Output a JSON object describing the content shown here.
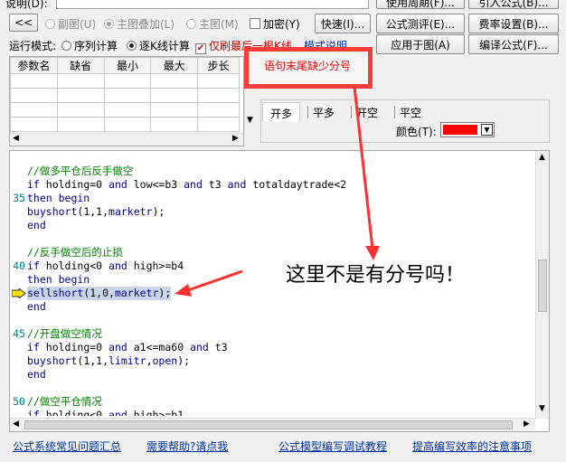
{
  "top": {
    "title_label": "说明(D):",
    "buttons_top": [
      "使用周期(F)...",
      "引入公式(B)..."
    ]
  },
  "row1": {
    "collapse": "<<",
    "radio_subchart": "副图(U)",
    "radio_overlay": "主图叠加(L)",
    "radio_main": "主图(M)",
    "check_encrypt": "加密(Y)",
    "btn_quick": "快速(I)...",
    "btn_test": "公式测评(E)...",
    "btn_fee": "费率设置(B)..."
  },
  "row2": {
    "mode_label": "运行模式:",
    "radio_seq": "序列计算",
    "radio_step": "逐K线计算",
    "check_tail": "仅刷最后一根K线",
    "link_doc": "模式说明",
    "btn_apply": "应用于图(A)",
    "btn_compile": "编译公式(F)..."
  },
  "params": {
    "headers": [
      "参数名",
      "缺省",
      "最小",
      "最大",
      "步长"
    ],
    "rows": 4
  },
  "error": {
    "message": "语句末尾缺少分号"
  },
  "tabs": [
    "开多",
    "平多",
    "开空",
    "平空"
  ],
  "color_label": "颜色(T):",
  "annotation": "这里不是有分号吗！",
  "code_lines": [
    {
      "num": "",
      "y": 0,
      "parts": [
        {
          "c": "cmt",
          "t": "//做多平仓后反手做空"
        }
      ]
    },
    {
      "num": "",
      "y": 1,
      "parts": [
        {
          "c": "kw",
          "t": "if"
        },
        {
          "c": "",
          "t": " holding=0 "
        },
        {
          "c": "kw",
          "t": "and"
        },
        {
          "c": "",
          "t": " low<=b3 "
        },
        {
          "c": "kw",
          "t": "and"
        },
        {
          "c": "",
          "t": " t3 "
        },
        {
          "c": "kw",
          "t": "and"
        },
        {
          "c": "",
          "t": " totaldaytrade<2"
        }
      ]
    },
    {
      "num": "35",
      "y": 2,
      "parts": [
        {
          "c": "kw",
          "t": "then begin"
        }
      ]
    },
    {
      "num": "",
      "y": 3,
      "parts": [
        {
          "c": "fn",
          "t": "buyshort"
        },
        {
          "c": "",
          "t": "(1,1,"
        },
        {
          "c": "fn",
          "t": "marketr"
        },
        {
          "c": "",
          "t": ");"
        }
      ]
    },
    {
      "num": "",
      "y": 4,
      "parts": [
        {
          "c": "kw",
          "t": "end"
        }
      ]
    },
    {
      "num": "",
      "y": 5,
      "parts": []
    },
    {
      "num": "",
      "y": 6,
      "parts": [
        {
          "c": "cmt",
          "t": "//反手做空后的止损"
        }
      ]
    },
    {
      "num": "40",
      "y": 7,
      "parts": [
        {
          "c": "kw",
          "t": "if"
        },
        {
          "c": "",
          "t": " holding<0 "
        },
        {
          "c": "kw",
          "t": "and"
        },
        {
          "c": "",
          "t": " high>=b4"
        }
      ]
    },
    {
      "num": "",
      "y": 8,
      "parts": [
        {
          "c": "kw",
          "t": "then begin"
        }
      ]
    },
    {
      "num": "",
      "y": 9,
      "parts": [
        {
          "c": "fn",
          "t": "sellshort"
        },
        {
          "c": "",
          "t": "(1,0,"
        },
        {
          "c": "fn",
          "t": "marketr"
        },
        {
          "c": "",
          "t": ");"
        }
      ],
      "hl": true
    },
    {
      "num": "",
      "y": 10,
      "parts": [
        {
          "c": "kw",
          "t": "end"
        }
      ]
    },
    {
      "num": "",
      "y": 11,
      "parts": []
    },
    {
      "num": "45",
      "y": 12,
      "parts": [
        {
          "c": "cmt",
          "t": "//开盘做空情况"
        }
      ]
    },
    {
      "num": "",
      "y": 13,
      "parts": [
        {
          "c": "kw",
          "t": "if"
        },
        {
          "c": "",
          "t": " holding=0 "
        },
        {
          "c": "kw",
          "t": "and"
        },
        {
          "c": "",
          "t": " a1<=ma60 "
        },
        {
          "c": "kw",
          "t": "and"
        },
        {
          "c": "",
          "t": " t3"
        }
      ]
    },
    {
      "num": "",
      "y": 14,
      "parts": [
        {
          "c": "fn",
          "t": "buyshort"
        },
        {
          "c": "",
          "t": "(1,1,"
        },
        {
          "c": "fn",
          "t": "limitr"
        },
        {
          "c": "",
          "t": ","
        },
        {
          "c": "fn",
          "t": "open"
        },
        {
          "c": "",
          "t": ");"
        }
      ]
    },
    {
      "num": "",
      "y": 15,
      "parts": [
        {
          "c": "kw",
          "t": "end"
        }
      ]
    },
    {
      "num": "",
      "y": 16,
      "parts": []
    },
    {
      "num": "50",
      "y": 17,
      "parts": [
        {
          "c": "cmt",
          "t": "//做空平仓情况"
        }
      ]
    },
    {
      "num": "",
      "y": 18,
      "parts": [
        {
          "c": "kw",
          "t": "if"
        },
        {
          "c": "",
          "t": " holding<0 "
        },
        {
          "c": "kw",
          "t": "and"
        },
        {
          "c": "",
          "t": " high>=b1"
        }
      ]
    }
  ],
  "links": [
    "公式系统常见问题汇总",
    "需要帮助?请点我",
    "公式模型编写调试教程",
    "提高编写效率的注意事项"
  ],
  "colors": {
    "error_box": "#ff3b3b",
    "error_text": "#e00000",
    "annotation_arrow": "#ff3030",
    "comment": "#008000",
    "keyword": "#00008b",
    "line_number": "#008080",
    "link": "#00329c"
  }
}
